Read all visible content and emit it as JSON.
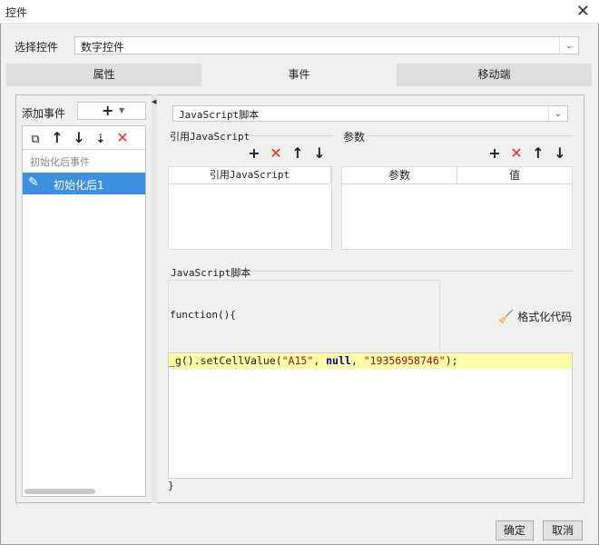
{
  "window": {
    "title": "控件",
    "close_icon": "close-icon"
  },
  "control_select": {
    "label": "选择控件",
    "value": "数字控件"
  },
  "tabs": [
    {
      "label": "属性"
    },
    {
      "label": "事件"
    },
    {
      "label": "移动端"
    }
  ],
  "left_panel": {
    "add_event_label": "添加事件",
    "add_icon": "plus-icon",
    "group_label": "初始化后事件",
    "items": [
      {
        "label": "初始化后1",
        "icon": "pencil-icon"
      }
    ]
  },
  "right_panel": {
    "script_type": "JavaScript脚本",
    "ref_js": {
      "label": "引用JavaScript",
      "column": "引用JavaScript"
    },
    "params": {
      "label": "参数",
      "columns": [
        "参数",
        "值"
      ]
    },
    "script_section_label": "JavaScript脚本",
    "function_header": "function(){",
    "format_button": "格式化代码",
    "code_line_prefix": "_g().setCellValue(",
    "code_arg1": "\"A15\"",
    "code_sep1": ", ",
    "code_null": "null",
    "code_sep2": ", ",
    "code_arg3": "\"19356958746\"",
    "code_line_suffix": ");",
    "closing_brace": "}"
  },
  "footer": {
    "ok": "确定",
    "cancel": "取消"
  }
}
